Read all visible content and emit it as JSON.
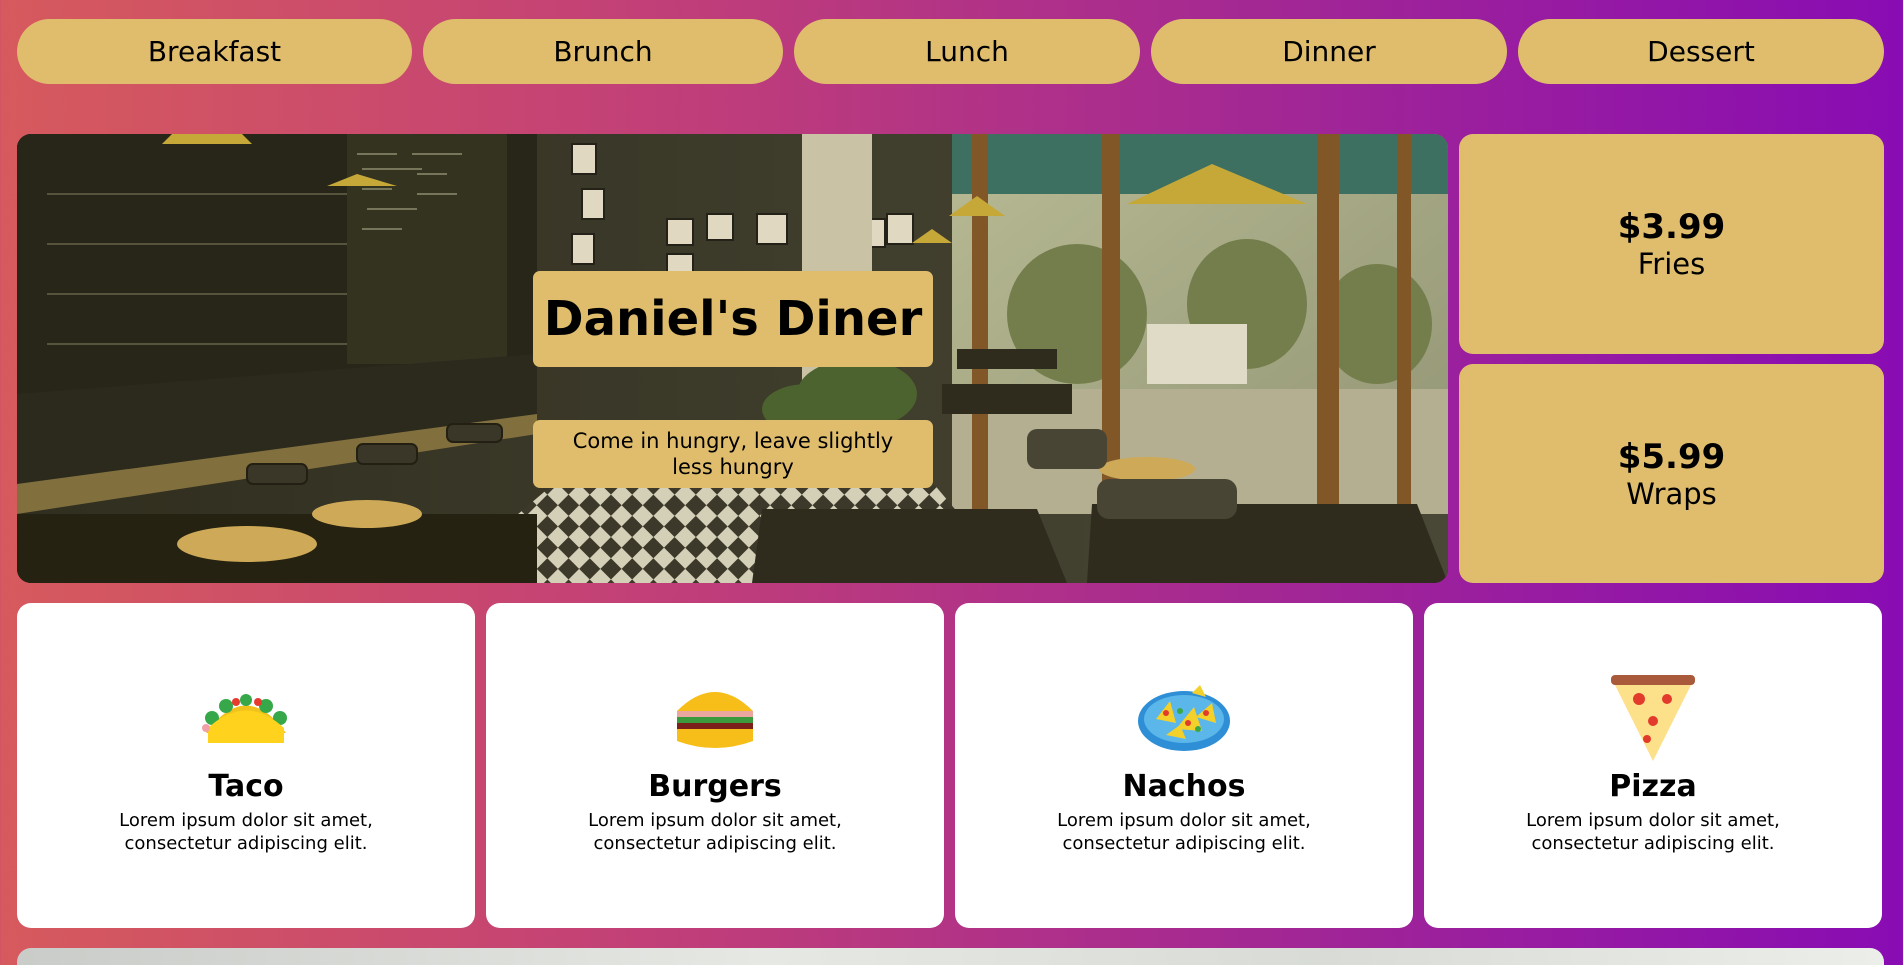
{
  "nav": {
    "items": [
      {
        "label": "Breakfast"
      },
      {
        "label": "Brunch"
      },
      {
        "label": "Lunch"
      },
      {
        "label": "Dinner"
      },
      {
        "label": "Dessert"
      }
    ]
  },
  "hero": {
    "title": "Daniel's Diner",
    "tagline": "Come in hungry, leave slightly less hungry"
  },
  "specials": [
    {
      "price": "$3.99",
      "label": "Fries"
    },
    {
      "price": "$5.99",
      "label": "Wraps"
    }
  ],
  "foods": [
    {
      "name": "Taco",
      "icon": "taco-icon",
      "desc": "Lorem ipsum dolor sit amet, consectetur adipiscing elit."
    },
    {
      "name": "Burgers",
      "icon": "burger-icon",
      "desc": "Lorem ipsum dolor sit amet, consectetur adipiscing elit."
    },
    {
      "name": "Nachos",
      "icon": "nachos-icon",
      "desc": "Lorem ipsum dolor sit amet, consectetur adipiscing elit."
    },
    {
      "name": "Pizza",
      "icon": "pizza-icon",
      "desc": "Lorem ipsum dolor sit amet, consectetur adipiscing elit."
    }
  ],
  "colors": {
    "accent": "#dfbd6d",
    "gradient_start": "#d65a5d",
    "gradient_end": "#880cb3",
    "card": "#ffffff"
  }
}
